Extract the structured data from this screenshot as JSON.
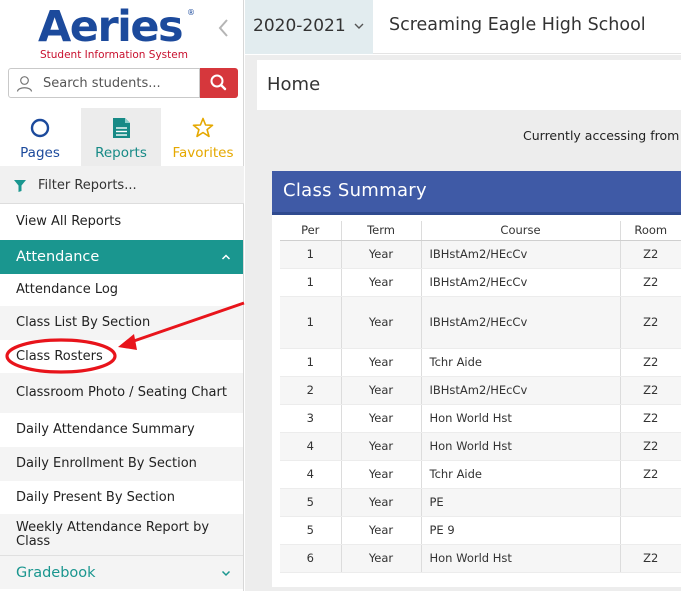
{
  "logo": {
    "word": "Aeries",
    "registered": "®",
    "tagline": "Student Information System"
  },
  "sidebar": {
    "collapse_icon": "chevron-left-icon",
    "search": {
      "placeholder": "Search students...",
      "icon": "search-icon"
    },
    "tabs": [
      {
        "label": "Pages",
        "icon": "circle-icon",
        "color": "#1c4a9c"
      },
      {
        "label": "Reports",
        "icon": "document-icon",
        "color": "#178a86",
        "active": true
      },
      {
        "label": "Favorites",
        "icon": "star-icon",
        "color": "#e5a800"
      }
    ],
    "filter": {
      "placeholder": "Filter Reports...",
      "icon": "filter-icon"
    },
    "view_all": "View All Reports",
    "sections": [
      {
        "label": "Attendance",
        "expanded": true,
        "color": "#1a968f"
      },
      {
        "label": "Gradebook",
        "expanded": false
      }
    ],
    "attendance_items": [
      "Attendance Log",
      "Class List By Section",
      "Class Rosters",
      "Classroom Photo / Seating Chart",
      "Daily Attendance Summary",
      "Daily Enrollment By Section",
      "Daily Present By Section",
      "Weekly Attendance Report by Class"
    ],
    "highlighted_item": "Class Rosters",
    "annotation_color": "#e8141b"
  },
  "topbar": {
    "year": "2020-2021",
    "school": "Screaming Eagle High School"
  },
  "main": {
    "page_title": "Home",
    "accessing_text": "Currently accessing from",
    "summary": {
      "title": "Class Summary",
      "header_color": "#3f5aa6",
      "columns": [
        "Per",
        "Term",
        "Course",
        "Room"
      ],
      "rows": [
        [
          "1",
          "Year",
          "IBHstAm2/HEcCv",
          "Z2"
        ],
        [
          "1",
          "Year",
          "IBHstAm2/HEcCv",
          "Z2"
        ],
        [
          "1",
          "Year",
          "IBHstAm2/HEcCv",
          "Z2"
        ],
        [
          "1",
          "Year",
          "Tchr Aide",
          "Z2"
        ],
        [
          "2",
          "Year",
          "IBHstAm2/HEcCv",
          "Z2"
        ],
        [
          "3",
          "Year",
          "Hon World Hst",
          "Z2"
        ],
        [
          "4",
          "Year",
          "Hon World Hst",
          "Z2"
        ],
        [
          "4",
          "Year",
          "Tchr Aide",
          "Z2"
        ],
        [
          "5",
          "Year",
          "PE",
          ""
        ],
        [
          "5",
          "Year",
          "PE 9",
          ""
        ],
        [
          "6",
          "Year",
          "Hon World Hst",
          "Z2"
        ]
      ]
    }
  }
}
